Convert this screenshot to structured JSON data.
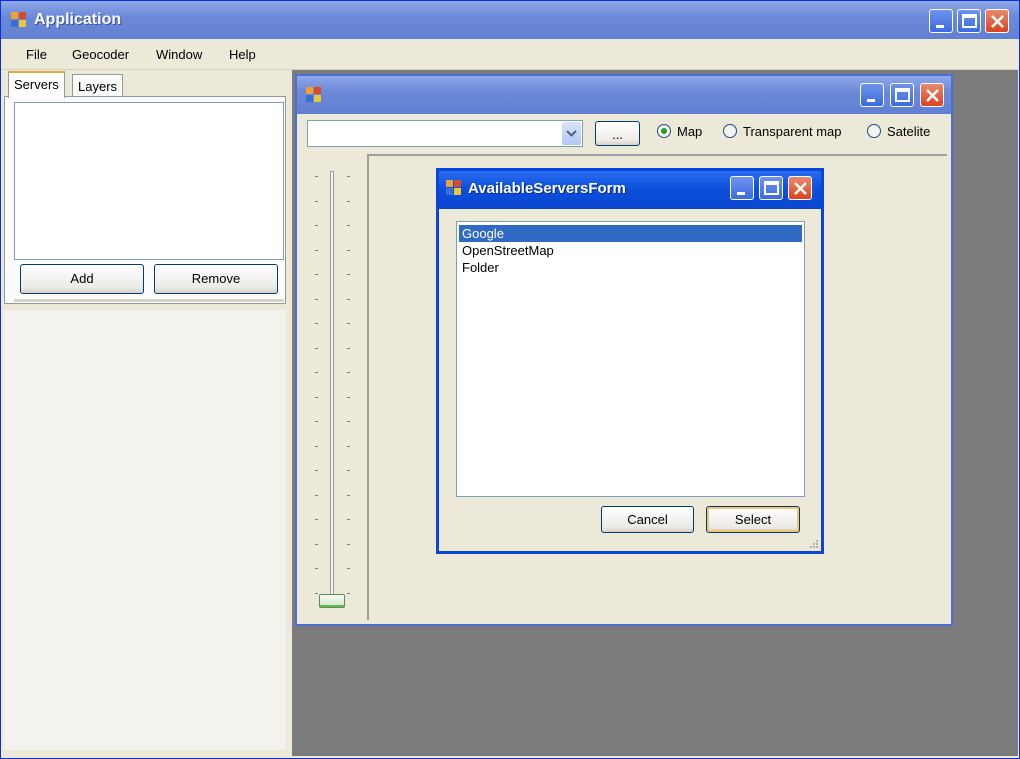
{
  "app": {
    "title": "Application",
    "menu": [
      "File",
      "Geocoder",
      "Window",
      "Help"
    ]
  },
  "left_panel": {
    "tabs": [
      "Servers",
      "Layers"
    ],
    "active_tab": "Servers",
    "add_label": "Add",
    "remove_label": "Remove"
  },
  "map_window": {
    "title": "",
    "browse_label": "...",
    "combo_value": "",
    "radios": [
      {
        "label": "Map",
        "selected": true
      },
      {
        "label": "Transparent map",
        "selected": false
      },
      {
        "label": "Satelite",
        "selected": false
      }
    ]
  },
  "dialog": {
    "title": "AvailableServersForm",
    "items": [
      "Google",
      "OpenStreetMap",
      "Folder"
    ],
    "selected_item": "Google",
    "cancel_label": "Cancel",
    "select_label": "Select"
  },
  "colors": {
    "window_face": "#ece9d8",
    "selection": "#316ac5",
    "dialog_titlebar": "#0a4fdb",
    "mdi_background": "#7b7b7b"
  },
  "icons": {
    "app_icon": "application-icon",
    "minimize": "minimize-icon",
    "maximize": "maximize-icon",
    "close": "close-icon",
    "dropdown": "chevron-down-icon"
  }
}
